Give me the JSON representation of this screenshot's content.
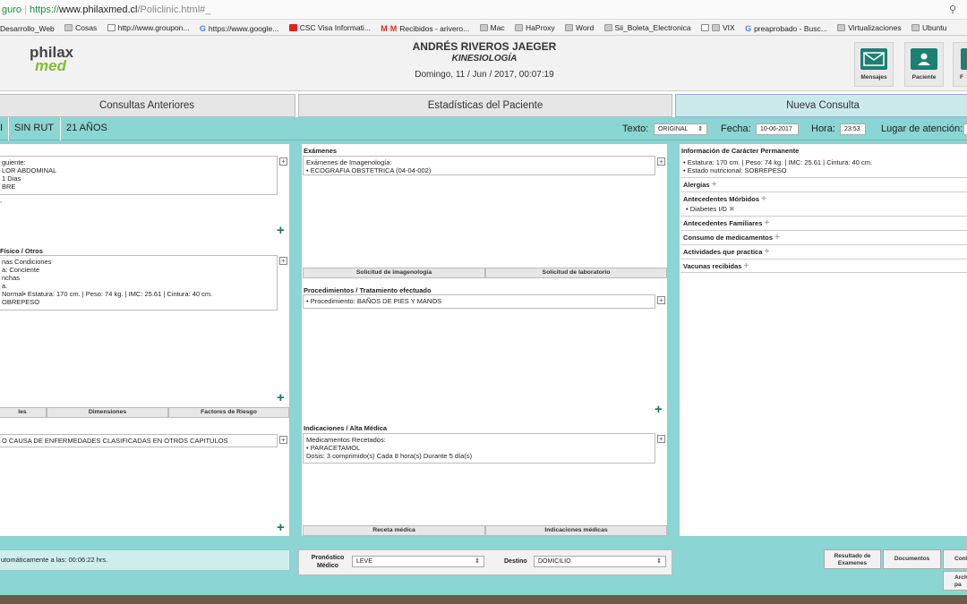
{
  "browser": {
    "security": "guro",
    "url_proto": "https://",
    "url_host": "www.philaxmed.cl",
    "url_path": "/Policlinic.html#_"
  },
  "bookmarks": [
    "Desarrollo_Web",
    "Cosas",
    "http://www.groupon...",
    "https://www.google...",
    "CSC Visa Informati...",
    "Recibidos - arivero...",
    "Mac",
    "HaProxy",
    "Word",
    "Sii_Boleta_Electronica",
    "VIX",
    "preaprobado - Busc...",
    "Virtualizaciones",
    "Ubuntu"
  ],
  "header": {
    "logo_top": "philax",
    "logo_bottom": "med",
    "doctor_name": "ANDRÉS RIVEROS JAEGER",
    "specialty": "KINESIOLOGÍA",
    "datetime": "Domingo, 11 / Jun / 2017, 00:07:19",
    "btn_messages": "Mensajes",
    "btn_patient": "Paciente",
    "btn_third": "F"
  },
  "tabs": {
    "previous": "Consultas Anteriores",
    "stats": "Estadísticas del Paciente",
    "new": "Nueva Consulta"
  },
  "band": {
    "left_frag": "I",
    "rut": "SIN RUT",
    "age": "21 AÑOS",
    "text_label": "Texto:",
    "text_value": "ORIGINAL",
    "date_label": "Fecha:",
    "date_value": "10-06-2017",
    "hour_label": "Hora:",
    "hour_value": "23:53",
    "place_label": "Lugar de atención:"
  },
  "left_col": {
    "box1_lines": [
      "guiente:",
      "LOR ABDOMINAL",
      "1 Dias",
      "BRE",
      "",
      ""
    ],
    "exam_title": "Físico / Otros",
    "box2_lines": [
      "nas Condiciones",
      "a: Conciente",
      "nchas",
      "a.",
      " Normal• Estatura: 170 cm. | Peso: 74 kg. | IMC: 25.61 | Cintura: 40 cm.",
      "OBREPESO"
    ],
    "btn_a": "les",
    "btn_b": "Dimensiones",
    "btn_c": "Factores de Riesgo",
    "box3_line": "O CAUSA DE ENFERMEDADES CLASIFICADAS EN OTROS CAPITULOS"
  },
  "mid_col": {
    "exams_title": "Exámenes",
    "exams_lines": [
      "Exámenes de Imagenología:",
      "• ECOGRAFIA OBSTETRICA (04-04-002)"
    ],
    "btn_img": "Solicitud de imagenología",
    "btn_lab": "Solicitud de laboratorio",
    "proc_title": "Procedimientos / Tratamiento efectuado",
    "proc_lines": [
      "• Procedimiento: BAÑOS DE PIES Y MANOS"
    ],
    "ind_title": "Indicaciones / Alta Médica",
    "ind_lines": [
      "Medicamentos Recetados:",
      "• PARACETAMOL",
      "Dosis: 3 comprimido(s) Cada 8 hora(s) Durante 5 día(s)"
    ],
    "btn_receta": "Receta médica",
    "btn_ind": "Indicaciones médicas"
  },
  "right_col": {
    "title": "Información de Carácter Permanente",
    "lines": [
      "• Estatura: 170 cm. | Peso: 74 kg. | IMC: 25.61 | Cintura: 40 cm.",
      "• Estado nutricional: SOBREPESO"
    ],
    "allergies": "Alergias",
    "morbid": "Antecedentes Mórbidos",
    "morbid_item": "• Diabetes I/D",
    "family": "Antecedentes Familiares",
    "meds": "Consumo de medicamentos",
    "activities": "Actividades que practica",
    "vaccines": "Vacunas recibidas"
  },
  "footer": {
    "autosave": "utomáticamente a las: 00:06:22 hrs.",
    "prognosis_label_1": "Pronóstico",
    "prognosis_label_2": "Médico",
    "prognosis_value": "LEVE",
    "dest_label": "Destino",
    "dest_value": "DOMICILIO",
    "btn_results_1": "Resultado de",
    "btn_results_2": "Examenes",
    "btn_docs": "Documentos",
    "btn_conf": "Conf",
    "btn_arch_1": "Arch",
    "btn_arch_2": "pa"
  }
}
